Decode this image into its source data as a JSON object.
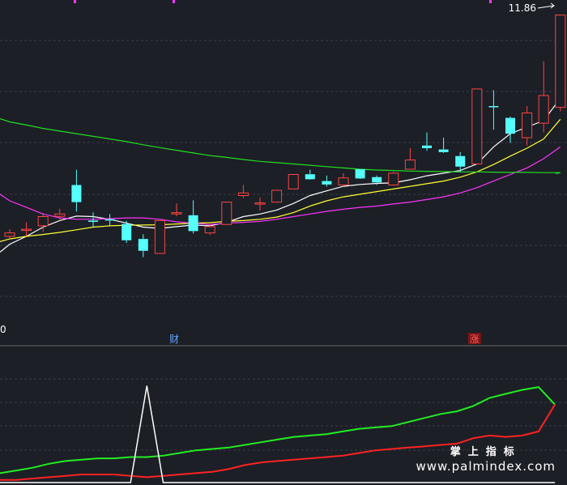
{
  "chart_data": [
    {
      "type": "candlestick",
      "price_label": "11.86",
      "left_axis_label": "0",
      "markers": [
        {
          "index": 10,
          "text": "财",
          "color": "#5fa8ff"
        },
        {
          "index": 28,
          "text": "涨",
          "color": "#ff5f5f"
        }
      ],
      "ylim": [
        0,
        12
      ],
      "candles": [
        {
          "o": 3.45,
          "c": 3.58,
          "h": 3.72,
          "l": 3.35
        },
        {
          "o": 3.7,
          "c": 3.72,
          "h": 3.98,
          "l": 3.46
        },
        {
          "o": 3.85,
          "c": 4.2,
          "h": 4.33,
          "l": 3.62
        },
        {
          "o": 4.21,
          "c": 4.3,
          "h": 4.5,
          "l": 4.04
        },
        {
          "o": 5.4,
          "c": 4.75,
          "h": 5.98,
          "l": 4.39
        },
        {
          "o": 4.05,
          "c": 4.0,
          "h": 4.36,
          "l": 3.8
        },
        {
          "o": 4.1,
          "c": 4.05,
          "h": 4.3,
          "l": 3.86
        },
        {
          "o": 3.92,
          "c": 3.3,
          "h": 4.04,
          "l": 3.2
        },
        {
          "o": 3.35,
          "c": 2.9,
          "h": 3.53,
          "l": 2.66
        },
        {
          "o": 2.8,
          "c": 4.05,
          "h": 4.05,
          "l": 2.8
        },
        {
          "o": 4.3,
          "c": 4.35,
          "h": 4.7,
          "l": 4.21
        },
        {
          "o": 4.25,
          "c": 3.65,
          "h": 4.82,
          "l": 3.56
        },
        {
          "o": 3.58,
          "c": 3.82,
          "h": 3.96,
          "l": 3.5
        },
        {
          "o": 3.9,
          "c": 4.75,
          "h": 4.75,
          "l": 3.9
        },
        {
          "o": 5.0,
          "c": 5.1,
          "h": 5.4,
          "l": 4.9
        },
        {
          "o": 4.68,
          "c": 4.72,
          "h": 4.92,
          "l": 4.43
        },
        {
          "o": 4.75,
          "c": 5.2,
          "h": 5.2,
          "l": 4.75
        },
        {
          "o": 5.25,
          "c": 5.8,
          "h": 5.8,
          "l": 5.25
        },
        {
          "o": 5.81,
          "c": 5.62,
          "h": 5.98,
          "l": 5.6
        },
        {
          "o": 5.55,
          "c": 5.42,
          "h": 5.76,
          "l": 5.34
        },
        {
          "o": 5.4,
          "c": 5.67,
          "h": 5.85,
          "l": 5.35
        },
        {
          "o": 6.0,
          "c": 5.65,
          "h": 6.0,
          "l": 5.63
        },
        {
          "o": 5.7,
          "c": 5.5,
          "h": 5.76,
          "l": 5.4
        },
        {
          "o": 5.4,
          "c": 5.85,
          "h": 5.9,
          "l": 5.4
        },
        {
          "o": 6.0,
          "c": 6.35,
          "h": 6.8,
          "l": 6.0
        },
        {
          "o": 6.9,
          "c": 6.8,
          "h": 7.4,
          "l": 6.7
        },
        {
          "o": 6.75,
          "c": 6.65,
          "h": 7.2,
          "l": 6.62
        },
        {
          "o": 6.5,
          "c": 6.1,
          "h": 6.65,
          "l": 5.9
        },
        {
          "o": 6.2,
          "c": 9.05,
          "h": 9.05,
          "l": 6.2
        },
        {
          "o": 8.4,
          "c": 8.36,
          "h": 9.0,
          "l": 7.5
        },
        {
          "o": 7.95,
          "c": 7.35,
          "h": 8.0,
          "l": 7.0
        },
        {
          "o": 7.2,
          "c": 8.14,
          "h": 8.4,
          "l": 6.9
        },
        {
          "o": 7.75,
          "c": 8.8,
          "h": 10.1,
          "l": 7.4
        },
        {
          "o": 8.35,
          "c": 11.86,
          "h": 11.86,
          "l": 8.2
        }
      ],
      "ma_lines": [
        {
          "color": "#ffffff",
          "values": [
            3.15,
            3.45,
            3.8,
            4.05,
            4.22,
            4.2,
            4.1,
            3.95,
            3.8,
            3.75,
            3.82,
            3.88,
            3.85,
            3.98,
            4.2,
            4.3,
            4.45,
            4.7,
            5.0,
            5.18,
            5.35,
            5.42,
            5.46,
            5.48,
            5.6,
            5.75,
            5.85,
            5.95,
            6.2,
            6.85,
            7.35,
            7.6,
            7.85,
            8.7
          ]
        },
        {
          "color": "#ffff33",
          "values": [
            3.35,
            3.45,
            3.52,
            3.6,
            3.7,
            3.8,
            3.85,
            3.87,
            3.88,
            3.89,
            3.92,
            3.95,
            3.97,
            4.02,
            4.05,
            4.1,
            4.18,
            4.35,
            4.6,
            4.8,
            4.95,
            5.05,
            5.15,
            5.25,
            5.35,
            5.45,
            5.55,
            5.7,
            5.9,
            6.18,
            6.5,
            6.8,
            7.15,
            7.9
          ]
        },
        {
          "color": "#ff33ff",
          "values": [
            4.8,
            4.55,
            4.3,
            4.15,
            4.1,
            4.1,
            4.12,
            4.15,
            4.15,
            4.1,
            4.0,
            3.95,
            3.9,
            3.95,
            3.98,
            4.02,
            4.1,
            4.2,
            4.3,
            4.4,
            4.48,
            4.55,
            4.6,
            4.68,
            4.75,
            4.85,
            4.95,
            5.1,
            5.3,
            5.55,
            5.8,
            6.05,
            6.4,
            6.85
          ]
        },
        {
          "color": "#22dd22",
          "values": [
            7.8,
            7.68,
            7.55,
            7.45,
            7.35,
            7.25,
            7.15,
            7.05,
            6.93,
            6.82,
            6.72,
            6.62,
            6.52,
            6.45,
            6.37,
            6.3,
            6.25,
            6.2,
            6.15,
            6.1,
            6.05,
            6.0,
            5.97,
            5.95,
            5.93,
            5.92,
            5.91,
            5.9,
            5.9,
            5.89,
            5.88,
            5.88,
            5.87,
            5.87
          ]
        }
      ]
    },
    {
      "type": "line",
      "ylim": [
        0,
        100
      ],
      "series": [
        {
          "color": "#22ee22",
          "values": [
            7,
            9,
            11,
            14,
            16,
            17,
            18,
            18,
            19,
            19,
            20,
            22,
            24,
            25,
            26,
            28,
            30,
            32,
            34,
            35,
            36,
            38,
            40,
            41,
            42,
            45,
            48,
            51,
            53,
            57,
            63,
            66,
            69,
            71,
            58
          ]
        },
        {
          "color": "#ff2222",
          "values": [
            2,
            2,
            3,
            4,
            5,
            6,
            6,
            6,
            5,
            4,
            5,
            6,
            7,
            8,
            10,
            13,
            15,
            16,
            17,
            18,
            19,
            20,
            22,
            24,
            25,
            26,
            27,
            28,
            29,
            33,
            35,
            34,
            35,
            38,
            58
          ]
        },
        {
          "color": "#ffffff",
          "values": [
            0,
            0,
            0,
            0,
            0,
            0,
            0,
            0,
            0,
            72,
            0,
            0,
            0,
            0,
            0,
            0,
            0,
            0,
            0,
            0,
            0,
            0,
            0,
            0,
            0,
            0,
            0,
            0,
            0,
            0,
            0,
            0,
            0,
            0,
            0
          ]
        }
      ]
    }
  ],
  "watermark": {
    "cn": "掌上指标",
    "url": "www.palmindex.com"
  }
}
